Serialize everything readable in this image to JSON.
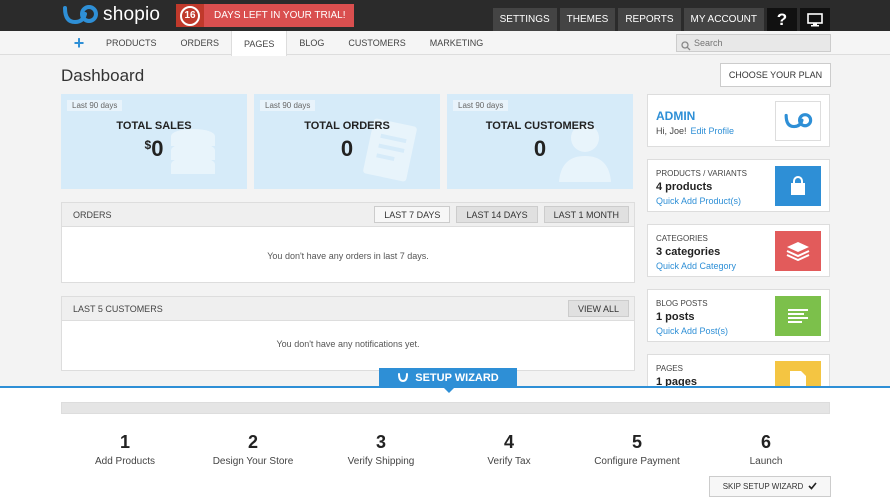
{
  "brand": {
    "name": "shopio",
    "accent": "#2e8fd6"
  },
  "trial": {
    "days": "16",
    "text": "DAYS LEFT IN YOUR TRIAL!"
  },
  "topnav": {
    "settings": "SETTINGS",
    "themes": "THEMES",
    "reports": "REPORTS",
    "account": "MY ACCOUNT",
    "help_icon": "?"
  },
  "subnav": {
    "items": [
      "PRODUCTS",
      "ORDERS",
      "PAGES",
      "BLOG",
      "CUSTOMERS",
      "MARKETING"
    ],
    "active": "PAGES",
    "search_placeholder": "Search"
  },
  "page": {
    "title": "Dashboard",
    "plan_button": "CHOOSE YOUR PLAN"
  },
  "stats": [
    {
      "tag": "Last 90 days",
      "title": "TOTAL SALES",
      "currency": "$",
      "value": "0"
    },
    {
      "tag": "Last 90 days",
      "title": "TOTAL ORDERS",
      "value": "0"
    },
    {
      "tag": "Last 90 days",
      "title": "TOTAL CUSTOMERS",
      "value": "0"
    }
  ],
  "orders": {
    "title": "ORDERS",
    "filters": [
      "Last 7 Days",
      "Last 14 Days",
      "Last 1 Month"
    ],
    "empty": "You don't have any orders in last 7 days."
  },
  "customers": {
    "title": "LAST 5 CUSTOMERS",
    "view_all": "View All",
    "empty": "You don't have any notifications yet."
  },
  "admin": {
    "name": "ADMIN",
    "greeting": "Hi, Joe!",
    "edit_link": "Edit Profile"
  },
  "cards": [
    {
      "title": "PRODUCTS / VARIANTS",
      "count": "4 products",
      "link": "Quick Add Product(s)",
      "color": "#2e8fd6",
      "icon": "shopping-bag-icon"
    },
    {
      "title": "CATEGORIES",
      "count": "3 categories",
      "link": "Quick Add Category",
      "color": "#e25b5b",
      "icon": "layers-icon"
    },
    {
      "title": "BLOG POSTS",
      "count": "1 posts",
      "link": "Quick Add Post(s)",
      "color": "#7cc04b",
      "icon": "text-lines-icon"
    },
    {
      "title": "PAGES",
      "count": "1 pages",
      "link": "",
      "color": "#f4c542",
      "icon": "page-icon"
    }
  ],
  "wizard": {
    "tab": "SETUP WIZARD",
    "steps": [
      {
        "num": "1",
        "label": "Add Products"
      },
      {
        "num": "2",
        "label": "Design Your Store"
      },
      {
        "num": "3",
        "label": "Verify Shipping"
      },
      {
        "num": "4",
        "label": "Verify Tax"
      },
      {
        "num": "5",
        "label": "Configure Payment"
      },
      {
        "num": "6",
        "label": "Launch"
      }
    ],
    "skip": "SKIP SETUP WIZARD"
  }
}
